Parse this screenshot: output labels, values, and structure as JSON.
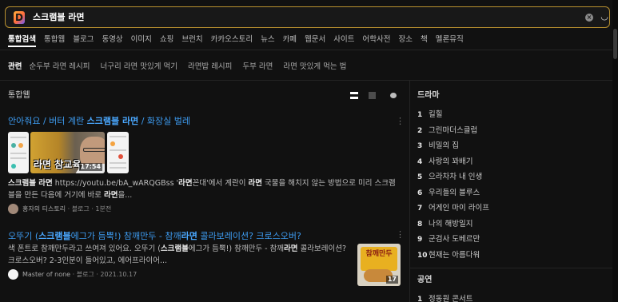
{
  "search": {
    "logo": "D",
    "query": "스크램블 라면",
    "clear_label": "×",
    "expand_label": "◡"
  },
  "tabs": [
    "통합검색",
    "통합웹",
    "블로그",
    "동영상",
    "이미지",
    "쇼핑",
    "브런치",
    "카카오스토리",
    "뉴스",
    "카페",
    "웹문서",
    "사이트",
    "어학사전",
    "장소",
    "책",
    "멜론뮤직"
  ],
  "related": {
    "label": "관련",
    "items": [
      "순두부 라면 레시피",
      "너구리 라면 맛있게 먹기",
      "라면밥 레시피",
      "두부 라면",
      "라면 맛있게 먹는 법"
    ]
  },
  "section_title": "통합웹",
  "results": [
    {
      "title_parts": [
        {
          "text": "안아줘요 / 버터 계란 ",
          "bold": false
        },
        {
          "text": "스크램블 라면",
          "bold": true
        },
        {
          "text": " / 화장실 벌레",
          "bold": false
        }
      ],
      "video_caption": "라면 참교육",
      "video_duration": "17:54",
      "snippet_parts": [
        {
          "text": "스크램블 라면",
          "bold": true
        },
        {
          "text": "  https://youtu.be/bA_wARQGBss  '",
          "bold": false
        },
        {
          "text": "라면",
          "bold": true
        },
        {
          "text": "꼰대'에서 계란이 ",
          "bold": false
        },
        {
          "text": "라면",
          "bold": true
        },
        {
          "text": " 국물을 해치지 않는 방법으로 미리 스크램블을 만든 다음에 거기에 바로 ",
          "bold": false
        },
        {
          "text": "라면",
          "bold": true
        },
        {
          "text": "을...",
          "bold": false
        }
      ],
      "author": "홍자의 티스토리",
      "meta": " · 블로그 · 1분전"
    },
    {
      "title_parts": [
        {
          "text": "오뚜기 (",
          "bold": false
        },
        {
          "text": "스크램블",
          "bold": true
        },
        {
          "text": "에그가 듬뿍!) 참깨만두 - 참깨",
          "bold": false
        },
        {
          "text": "라면",
          "bold": true
        },
        {
          "text": " 콜라보레이션? 크로스오버?",
          "bold": false
        }
      ],
      "snippet_parts": [
        {
          "text": "색 폰트로 참깨만두라고 쓰여져 있어요. 오뚜기 (",
          "bold": false
        },
        {
          "text": "스크램블",
          "bold": true
        },
        {
          "text": "에그가 듬뿍!) 참깨만두 - 참깨",
          "bold": false
        },
        {
          "text": "라면",
          "bold": true
        },
        {
          "text": " 콜라보레이션? 크로스오버? 2-3인분이 들어있고, 에어프라이어...",
          "bold": false
        }
      ],
      "author": "Master of none",
      "meta": " · 블로그 · 2021.10.17",
      "thumb_label": "참깨만두",
      "thumb_count": "17"
    }
  ],
  "sidebar": {
    "drama_title": "드라마",
    "drama": [
      {
        "rank": "1",
        "name": "킬힐"
      },
      {
        "rank": "2",
        "name": "그린마더스클럽"
      },
      {
        "rank": "3",
        "name": "비밀의 집"
      },
      {
        "rank": "4",
        "name": "사랑의 꽈배기"
      },
      {
        "rank": "5",
        "name": "으라차차 내 인생"
      },
      {
        "rank": "6",
        "name": "우리들의 블루스"
      },
      {
        "rank": "7",
        "name": "어게인 마이 라이프"
      },
      {
        "rank": "8",
        "name": "나의 해방일지"
      },
      {
        "rank": "9",
        "name": "군검사 도베르만"
      },
      {
        "rank": "10",
        "name": "현재는 아름다워"
      }
    ],
    "concert_title": "공연",
    "concert": [
      {
        "rank": "1",
        "name": "정동원 콘서트"
      }
    ]
  },
  "colors": {
    "accent": "#b8902f",
    "link": "#3d9bf0",
    "background": "#111111"
  }
}
